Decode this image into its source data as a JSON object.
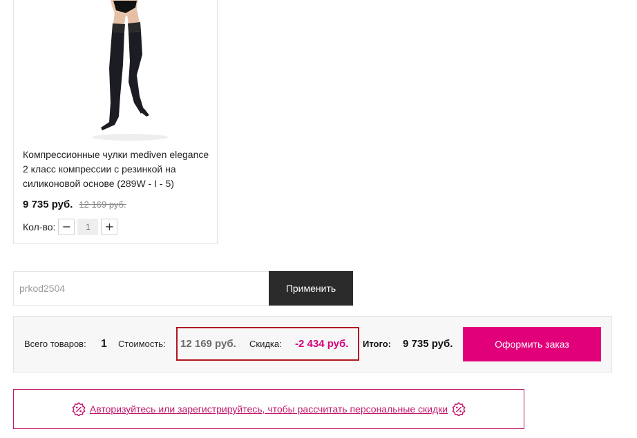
{
  "product": {
    "title": "Компрессионные чулки mediven elegance 2 класс компрессии с резинкой на силиконовой основе (289W - I - 5)",
    "price_new": "9 735 руб.",
    "price_old": "12 169 руб.",
    "qty_label": "Кол-во:",
    "qty_value": "1",
    "qty_minus": "−",
    "qty_plus": "+"
  },
  "promo": {
    "code_value": "prkod2504",
    "apply_label": "Применить"
  },
  "summary": {
    "items_label": "Всего товаров:",
    "items_count": "1",
    "cost_label": "Стоимость:",
    "cost_value": "12 169 руб.",
    "discount_label": "Скидка:",
    "discount_value": "-2 434 руб.",
    "total_label": "Итого:",
    "total_value": "9 735 руб.",
    "checkout_label": "Оформить заказ"
  },
  "auth": {
    "link_text": "Авторизуйтесь или зарегистрируйтесь, чтобы рассчитать персональные скидки",
    "icon": "percent-badge-icon"
  },
  "colors": {
    "accent": "#e2007a",
    "discount": "#d6007d",
    "highlight_border": "#b0161f",
    "dark_button": "#2b2b2b"
  }
}
